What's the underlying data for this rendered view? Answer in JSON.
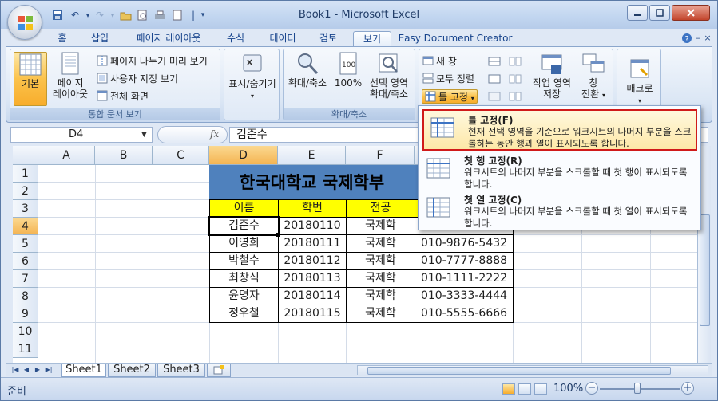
{
  "window": {
    "title": "Book1 - Microsoft Excel"
  },
  "tabs": [
    "홈",
    "삽입",
    "페이지 레이아웃",
    "수식",
    "데이터",
    "검토",
    "보기",
    "Easy Document Creator"
  ],
  "active_tab": "보기",
  "ribbon": {
    "groups": {
      "workbook_views": {
        "label": "통합 문서 보기",
        "normal": "기본",
        "page_layout_line1": "페이지",
        "page_layout_line2": "레이아웃",
        "page_break_preview": "페이지 나누기 미리 보기",
        "custom_views": "사용자 지정 보기",
        "full_screen": "전체 화면"
      },
      "show_hide": {
        "label": "표시/숨기기"
      },
      "zoom": {
        "label": "확대/축소",
        "zoom": "확대/축소",
        "zoom100": "100%",
        "zoom_selection_line1": "선택 영역",
        "zoom_selection_line2": "확대/축소"
      },
      "window": {
        "new_window": "새 창",
        "arrange_all": "모두 정렬",
        "freeze_panes": "틀 고정",
        "save_workspace_line1": "작업 영역",
        "save_workspace_line2": "저장",
        "switch_windows_line1": "창",
        "switch_windows_line2": "전환"
      },
      "macros": {
        "label": "매크로"
      }
    }
  },
  "formula_bar": {
    "name_box": "D4",
    "fx": "fx",
    "value": "김준수"
  },
  "columns": [
    "A",
    "B",
    "C",
    "D",
    "E",
    "F"
  ],
  "rows": [
    "1",
    "2",
    "3",
    "4",
    "5",
    "6",
    "7",
    "8",
    "9",
    "10",
    "11"
  ],
  "sheet": {
    "title": "한국대학교 국제학부",
    "headers": [
      "이름",
      "학번",
      "전공"
    ],
    "records": [
      [
        "김준수",
        "20180110",
        "국제학",
        ""
      ],
      [
        "이영희",
        "20180111",
        "국제학",
        "010-9876-5432"
      ],
      [
        "박철수",
        "20180112",
        "국제학",
        "010-7777-8888"
      ],
      [
        "최창식",
        "20180113",
        "국제학",
        "010-1111-2222"
      ],
      [
        "윤명자",
        "20180114",
        "국제학",
        "010-3333-4444"
      ],
      [
        "정우철",
        "20180115",
        "국제학",
        "010-5555-6666"
      ]
    ]
  },
  "sheet_tabs": [
    "Sheet1",
    "Sheet2",
    "Sheet3"
  ],
  "status": {
    "ready": "준비",
    "zoom": "100%"
  },
  "freeze_menu": {
    "items": [
      {
        "title": "틀 고정(F)",
        "desc": "현재 선택 영역을 기준으로 워크시트의 나머지 부분을 스크롤하는 동안 행과 열이 표시되도록 합니다."
      },
      {
        "title": "첫 행 고정(R)",
        "desc": "워크시트의 나머지 부분을 스크롤할 때 첫 행이 표시되도록 합니다."
      },
      {
        "title": "첫 열 고정(C)",
        "desc": "워크시트의 나머지 부분을 스크롤할 때 첫 열이 표시되도록 합니다."
      }
    ]
  },
  "colors": {
    "title_fill": "#4f81bd",
    "header_fill": "#ffff00",
    "highlight_border": "#d01a1a"
  }
}
